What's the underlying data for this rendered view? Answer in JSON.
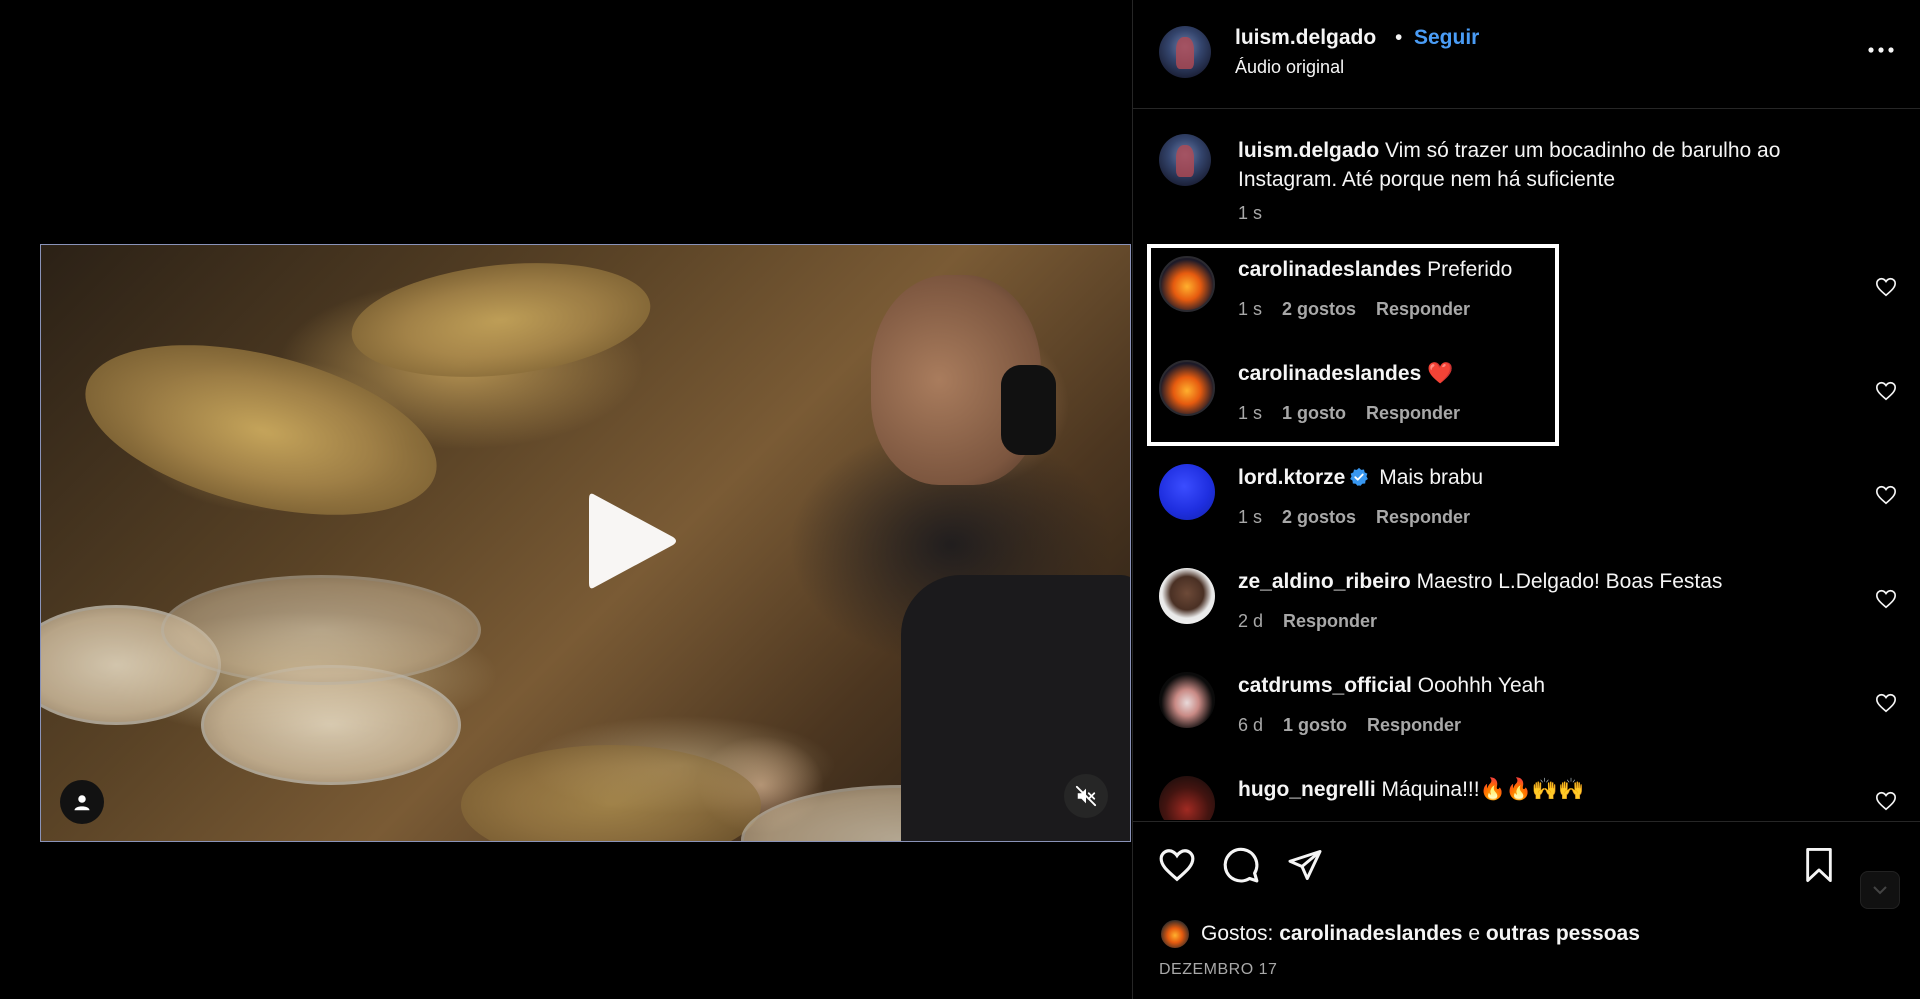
{
  "post": {
    "username": "luism.delgado",
    "separator": "•",
    "follow_label": "Seguir",
    "audio_label": "Áudio original",
    "caption_user": "luism.delgado",
    "caption_text": "Vim só trazer um bocadinho de barulho ao Instagram. Até porque nem há suficiente",
    "caption_time": "1 s"
  },
  "comments": [
    {
      "user": "carolinadeslandes",
      "text": "Preferido",
      "time": "1 s",
      "likes": "2 gostos",
      "reply": "Responder",
      "avatar": "flame-avatar",
      "verified": false
    },
    {
      "user": "carolinadeslandes",
      "text": "❤️",
      "time": "1 s",
      "likes": "1 gosto",
      "reply": "Responder",
      "avatar": "flame-avatar",
      "verified": false
    },
    {
      "user": "lord.ktorze",
      "text": "Mais brabu",
      "time": "1 s",
      "likes": "2 gostos",
      "reply": "Responder",
      "avatar": "blue-avatar",
      "verified": true
    },
    {
      "user": "ze_aldino_ribeiro",
      "text": "Maestro L.Delgado! Boas Festas",
      "time": "2 d",
      "likes": "",
      "reply": "Responder",
      "avatar": "person-avatar",
      "verified": false
    },
    {
      "user": "catdrums_official",
      "text": "Ooohhh Yeah",
      "time": "6 d",
      "likes": "1 gosto",
      "reply": "Responder",
      "avatar": "drum-avatar",
      "verified": false
    },
    {
      "user": "hugo_negrelli",
      "text": "Máquina!!!🔥🔥🙌🙌",
      "time": "",
      "likes": "",
      "reply": "",
      "avatar": "red-avatar",
      "verified": false
    }
  ],
  "likes_summary": {
    "prefix": "Gostos:",
    "user": "carolinadeslandes",
    "conjunction": "e",
    "others": "outras pessoas"
  },
  "date": "DEZEMBRO 17",
  "icons": {
    "play": "play-icon",
    "user_tag": "user-tag-icon",
    "mute": "muted-speaker-icon",
    "more": "more-options-icon",
    "like": "heart-icon",
    "comment": "comment-bubble-icon",
    "share": "paper-plane-icon",
    "save": "bookmark-icon"
  },
  "colors": {
    "background": "#000000",
    "link_blue": "#4a9cf5",
    "muted_text": "#a8a8a8",
    "highlight_border": "#ffffff"
  }
}
